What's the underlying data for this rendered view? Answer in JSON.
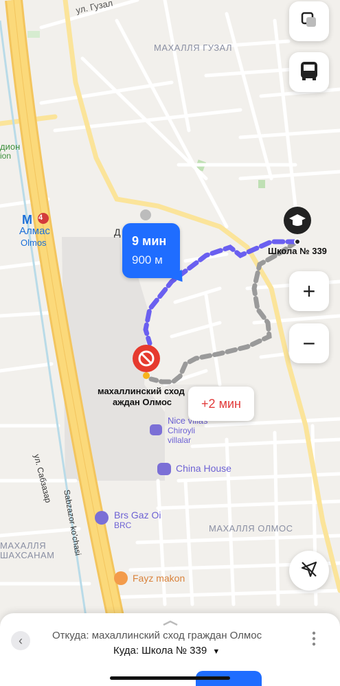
{
  "map": {
    "streets": {
      "guzal": "ул. Гузал",
      "sabzazar": "ул. Сабзазар",
      "sabzazor": "Sabzazor ko'chasi"
    },
    "districts": {
      "guzal": "МАХАЛЛЯ ГУЗАЛ",
      "olmos": "МАХАЛЛЯ ОЛМОС",
      "shakhsanam": "МАХАЛЛЯ ШАХСАНАМ"
    },
    "metro": {
      "line": "4",
      "name_ru": "Алмас",
      "name_uz": "Olmos"
    },
    "stadium": {
      "line1": "дион",
      "line2": "ion"
    },
    "poi_partial": "Д",
    "pois": {
      "nice_villas_1": "Nice villas",
      "nice_villas_2": "Chiroyli",
      "nice_villas_3": "villalar",
      "china_house": "China House",
      "brs_gaz": "Brs Gaz Oi",
      "brs_gaz_sub": "BRC",
      "fayz": "Fayz makon"
    },
    "origin_label_1": "махаллинский сход",
    "origin_label_2": "аждан Олмос",
    "destination_label": "Школа № 339"
  },
  "route": {
    "time": "9 мин",
    "distance": "900 м"
  },
  "alt_route": {
    "extra_time": "+2 мин"
  },
  "colors": {
    "route": "#6a5ff0",
    "alt_route": "#9a9a9a",
    "accent": "#1f6dff",
    "origin_pin": "#e63a2e"
  },
  "controls": {
    "layers_icon": "layers-icon",
    "transit_icon": "bus-icon",
    "zoom_in": "+",
    "zoom_out": "−",
    "compass_icon": "location-arrow-off-icon"
  },
  "bottom": {
    "from": "Откуда: махаллинский сход граждан Олмос",
    "to": "Куда: Школа № 339"
  }
}
